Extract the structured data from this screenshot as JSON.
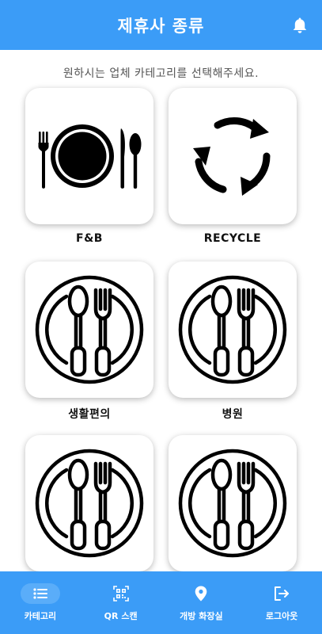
{
  "header": {
    "title": "제휴사 종류",
    "icon": "bell-icon"
  },
  "subtitle": "원하시는 업체 카테고리를 선택해주세요.",
  "categories": [
    {
      "label": "F&B",
      "icon": "plate-fork-knife-spoon-icon"
    },
    {
      "label": "RECYCLE",
      "icon": "recycle-arrows-icon"
    },
    {
      "label": "생활편의",
      "icon": "plate-spoon-fork-icon"
    },
    {
      "label": "병원",
      "icon": "plate-spoon-fork-icon"
    },
    {
      "label": "",
      "icon": "plate-spoon-fork-icon"
    },
    {
      "label": "",
      "icon": "plate-spoon-fork-icon"
    }
  ],
  "tabs": [
    {
      "label": "카테고리",
      "icon": "list-icon",
      "active": true
    },
    {
      "label": "QR 스캔",
      "icon": "qr-code-icon",
      "active": false
    },
    {
      "label": "개방 화장실",
      "icon": "location-pin-icon",
      "active": false
    },
    {
      "label": "로그아웃",
      "icon": "logout-icon",
      "active": false
    }
  ],
  "colors": {
    "primary": "#3b9cf7",
    "active_tab_bg": "#5aadf9",
    "text": "#111111"
  }
}
